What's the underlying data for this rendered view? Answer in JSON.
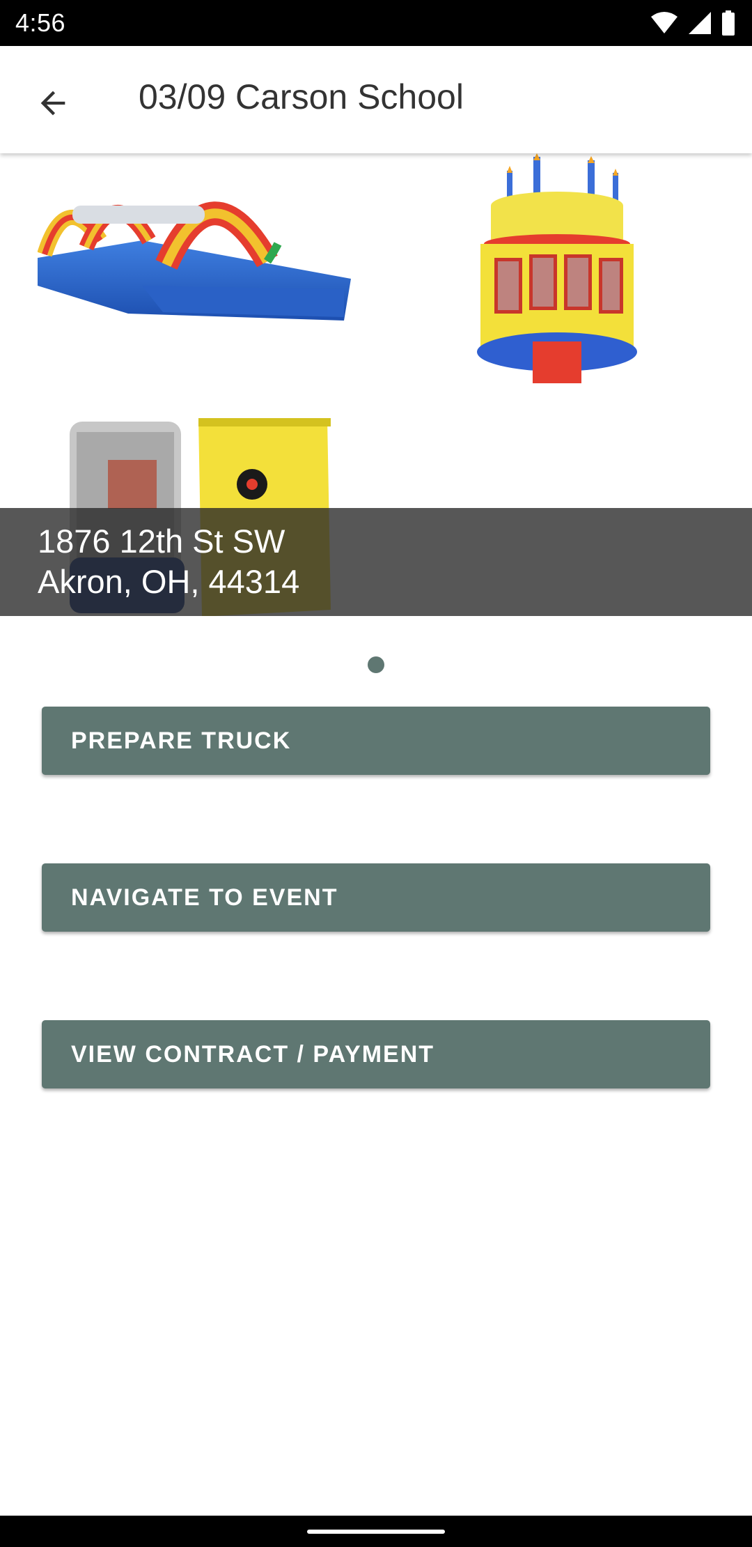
{
  "status_bar": {
    "time": "4:56",
    "icons": [
      "wifi-icon",
      "cellular-signal-icon",
      "battery-icon"
    ]
  },
  "app_bar": {
    "back_icon": "arrow-back-icon",
    "title": "03/09 Carson School"
  },
  "hero": {
    "images": [
      "inflatable-water-slide",
      "birthday-cake-bounce-house",
      "dunk-tank"
    ],
    "address_line1": "1876 12th St SW",
    "address_line2": "Akron, OH, 44314"
  },
  "pager": {
    "pages": 1,
    "current": 1
  },
  "actions": {
    "prepare_truck": "PREPARE TRUCK",
    "navigate": "NAVIGATE TO EVENT",
    "contract": "VIEW CONTRACT / PAYMENT"
  },
  "colors": {
    "button": "#5f7772",
    "status_bar": "#000000",
    "overlay": "#282828"
  }
}
